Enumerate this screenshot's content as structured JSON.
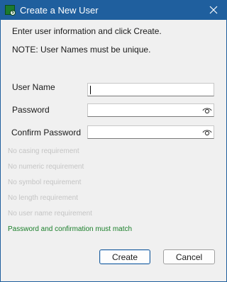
{
  "window": {
    "title": "Create a New User"
  },
  "instructions": {
    "line1": "Enter user information and click Create.",
    "line2": "NOTE: User Names must be unique."
  },
  "fields": {
    "username_label": "User Name",
    "username_value": "",
    "password_label": "Password",
    "password_value": "",
    "confirm_label": "Confirm Password",
    "confirm_value": ""
  },
  "requirements": [
    "No casing requirement",
    "No numeric requirement",
    "No symbol requirement",
    "No length requirement",
    "No user name requirement"
  ],
  "match_message": "Password and confirmation must match",
  "buttons": {
    "create": "Create",
    "cancel": "Cancel"
  },
  "colors": {
    "titlebar": "#1f5f9e",
    "requirement_text": "#c4c4c4",
    "match_text": "#1a7f2a"
  },
  "icons": {
    "app": "user-app-icon",
    "close": "close-icon",
    "reveal": "eye-icon"
  }
}
